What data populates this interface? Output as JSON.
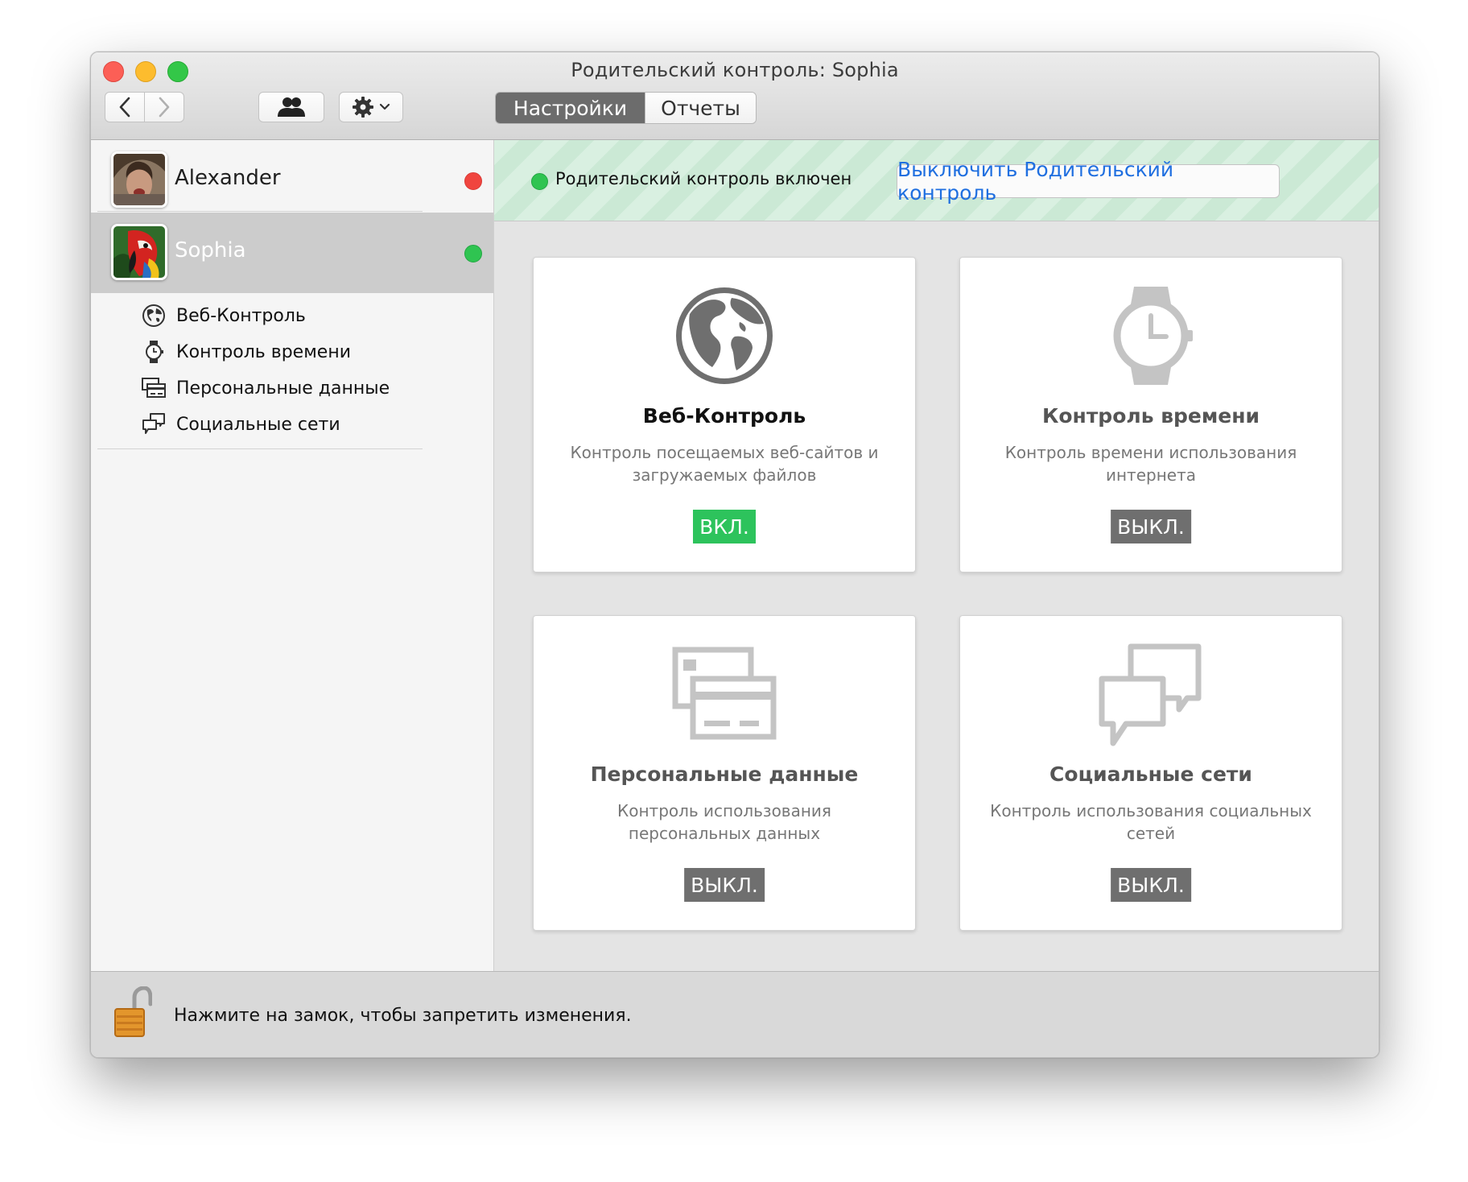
{
  "window": {
    "title": "Родительский контроль: Sophia"
  },
  "toolbar": {
    "back_icon": "chevron-left-icon",
    "forward_icon": "chevron-right-icon",
    "users_icon": "users-icon",
    "gear_icon": "gear-icon",
    "tabs": [
      {
        "label": "Настройки",
        "active": true
      },
      {
        "label": "Отчеты",
        "active": false
      }
    ]
  },
  "sidebar": {
    "users": [
      {
        "name": "Alexander",
        "status_color": "#f0453f",
        "selected": false
      },
      {
        "name": "Sophia",
        "status_color": "#2fc451",
        "selected": true
      }
    ],
    "sub_items": [
      {
        "label": "Веб-Контроль",
        "icon": "globe-icon"
      },
      {
        "label": "Контроль времени",
        "icon": "watch-icon"
      },
      {
        "label": "Персональные данные",
        "icon": "cards-icon"
      },
      {
        "label": "Социальные сети",
        "icon": "chat-icon"
      }
    ]
  },
  "status": {
    "text": "Родительский контроль включен",
    "color": "#2fc451",
    "button": "Выключить Родительский контроль"
  },
  "cards": [
    {
      "title": "Веб-Контроль",
      "description": "Контроль посещаемых веб-сайтов и загружаемых файлов",
      "state": "ВКЛ.",
      "icon": "globe-icon"
    },
    {
      "title": "Контроль времени",
      "description": "Контроль времени использования интернета",
      "state": "ВЫКЛ.",
      "icon": "watch-icon"
    },
    {
      "title": "Персональные данные",
      "description": "Контроль использования персональных данных",
      "state": "ВЫКЛ.",
      "icon": "cards-icon"
    },
    {
      "title": "Социальные сети",
      "description": "Контроль использования социальных сетей",
      "state": "ВЫКЛ.",
      "icon": "chat-icon"
    }
  ],
  "footer": {
    "text": "Нажмите на замок, чтобы запретить изменения.",
    "icon": "lock-open-icon"
  },
  "colors": {
    "on": "#2dc35c",
    "off": "#6f6f6f",
    "link": "#1f6fe0",
    "active_tab": "#6c6c6c"
  }
}
